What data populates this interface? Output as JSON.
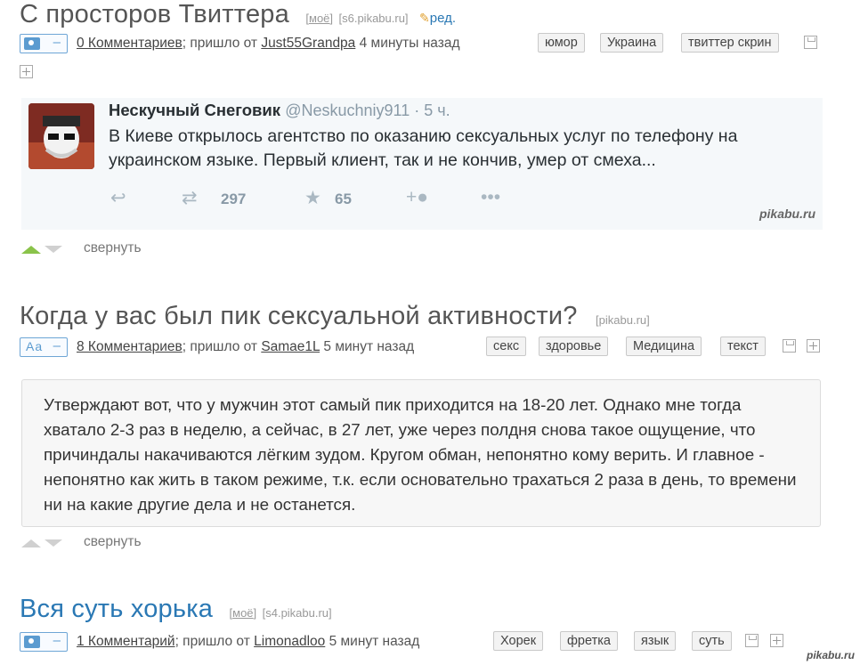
{
  "posts": [
    {
      "title": "С просторов Твиттера",
      "moe": "моё",
      "domain": "[s6.pikabu.ru]",
      "edit": "ред.",
      "comments": "0 Комментариев",
      "from": "; пришло от ",
      "author": "Just55Grandpa",
      "time": " 4 минуты назад",
      "tags": [
        "юмор",
        "Украина",
        "твиттер скрин"
      ],
      "collapse": "свернуть",
      "tweet": {
        "name": "Нескучный Снеговик",
        "handle": "@Neskuchniy911 · 5 ч.",
        "text": "В Киеве открылось  агентство по оказанию сексуальных услуг по телефону на украинском языке. Первый клиент, так и не кончив, умер от смеха...",
        "retweets": "297",
        "favorites": "65",
        "watermark": "pikabu.ru",
        "icons": [
          "reply-icon",
          "retweet-icon",
          "star-icon",
          "follow-icon",
          "more-icon"
        ]
      }
    },
    {
      "title": "Когда у вас был пик сексуальной активности?",
      "domain": "[pikabu.ru]",
      "badge": "Aa",
      "comments": "8 Комментариев",
      "from": "; пришло от ",
      "author": "Samae1L",
      "time": " 5 минут назад",
      "tags": [
        "секс",
        "здоровье",
        "Медицина",
        "текст"
      ],
      "body": "Утверждают вот, что у мужчин этот самый пик приходится на 18-20 лет. Однако мне тогда хватало 2-3 раз в неделю, а сейчас, в 27 лет, уже через полдня снова такое ощущение, что причиндалы накачиваются лёгким зудом. Кругом обман, непонятно кому верить. И главное - непонятно как жить в таком режиме, т.к. если основательно трахаться 2 раза в день, то времени ни на какие другие дела и не останется.",
      "collapse": "свернуть"
    },
    {
      "title": "Вся суть хорька",
      "moe": "моё",
      "domain": "[s4.pikabu.ru]",
      "comments": "1 Комментарий",
      "from": "; пришло от ",
      "author": "Limonadloo",
      "time": " 5 минут назад",
      "tags": [
        "Хорек",
        "фретка",
        "язык",
        "суть"
      ]
    }
  ],
  "footer_watermark": "pikabu.ru",
  "colors": {
    "link_blue": "#2a78b4",
    "upvote_green": "#8ac34a",
    "tweet_bg": "#f5f8fa"
  }
}
